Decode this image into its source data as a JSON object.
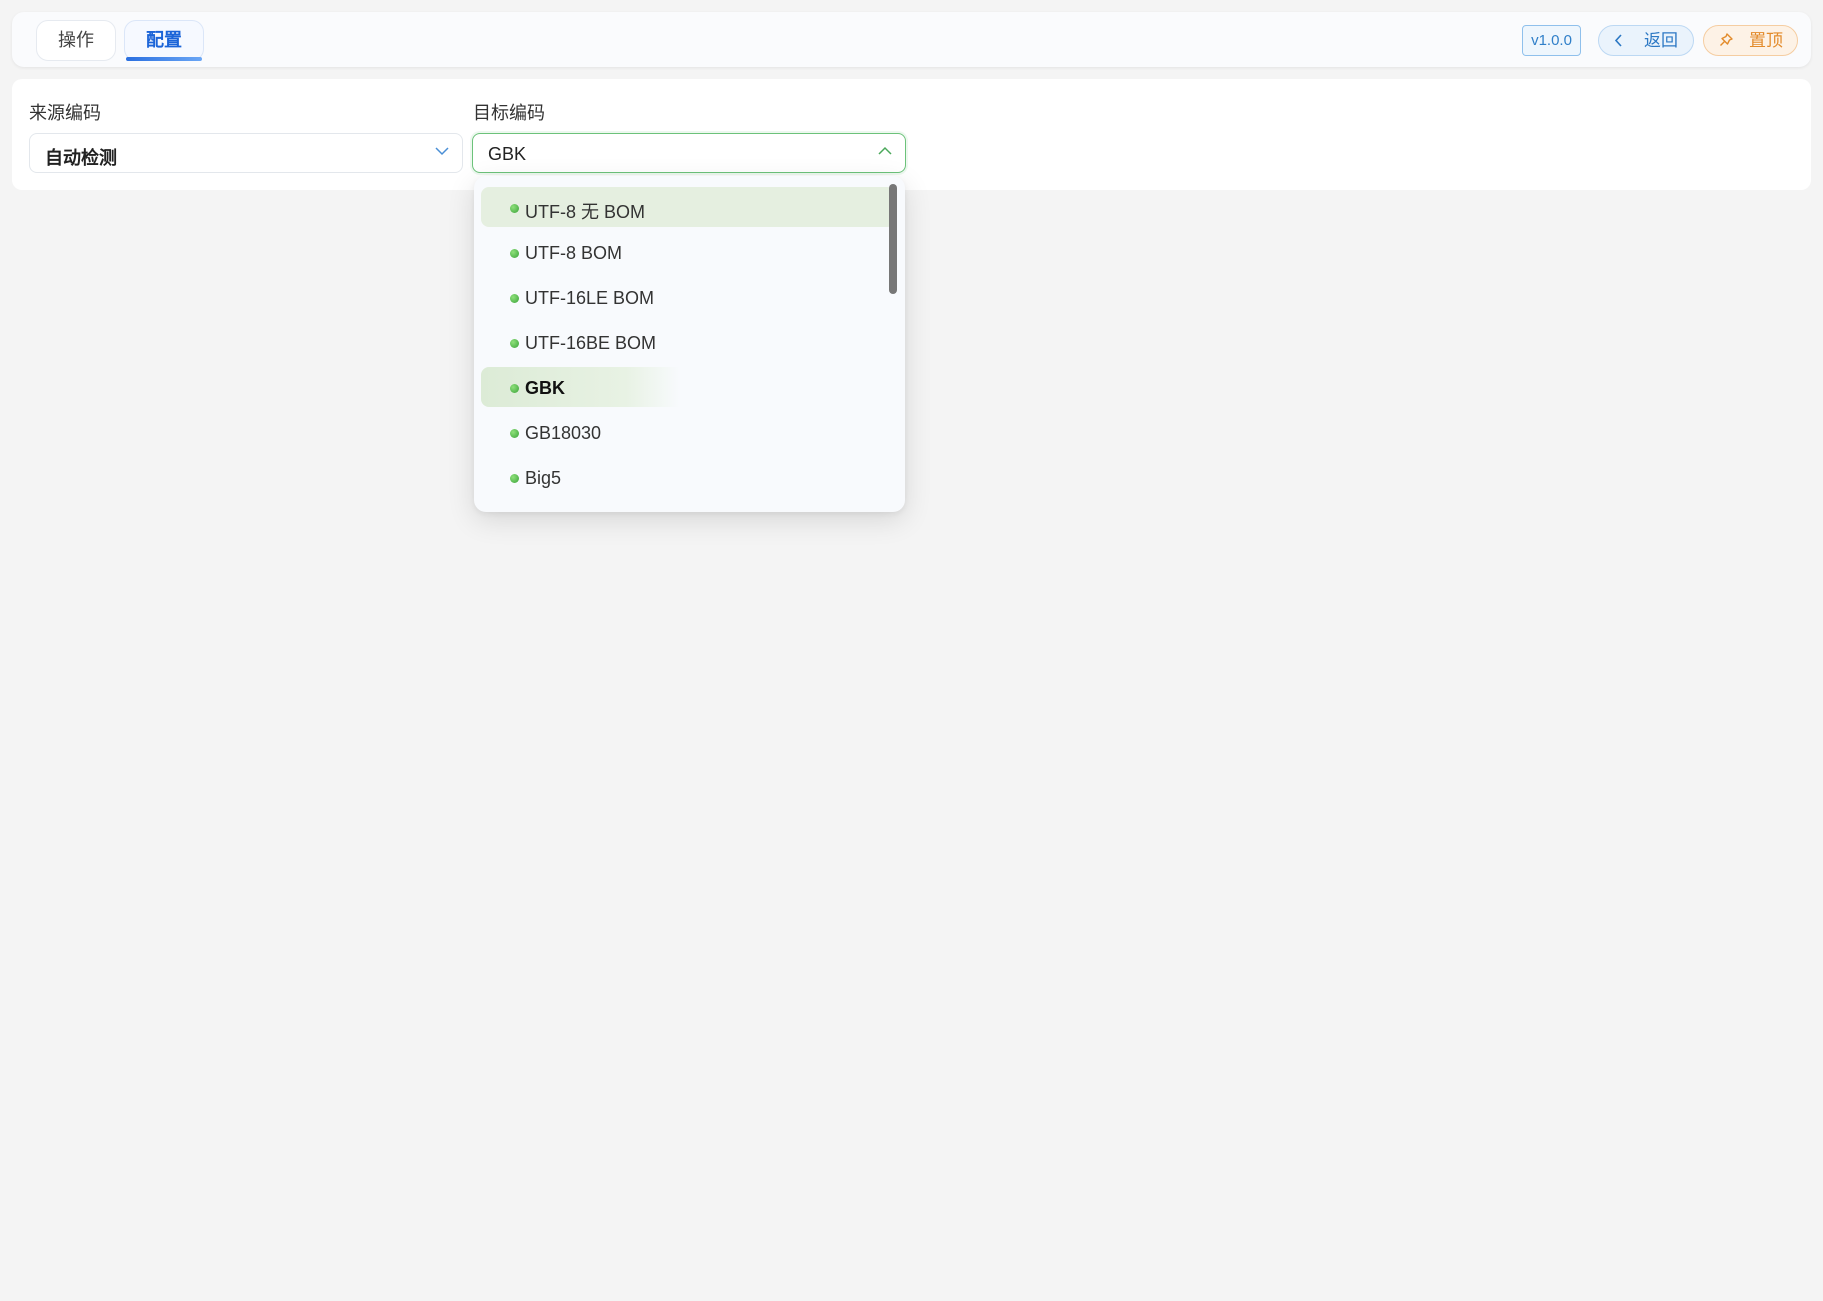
{
  "tabs": [
    {
      "label": "操作",
      "active": false
    },
    {
      "label": "配置",
      "active": true
    }
  ],
  "header": {
    "version": "v1.0.0",
    "back_label": "返回",
    "pin_label": "置顶",
    "back_icon": "chevron-left-icon",
    "pin_icon": "pin-icon"
  },
  "source": {
    "label": "来源编码",
    "value": "自动检测"
  },
  "target": {
    "label": "目标编码",
    "value": "GBK",
    "options": [
      "UTF-8 无 BOM",
      "UTF-8 BOM",
      "UTF-16LE BOM",
      "UTF-16BE BOM",
      "GBK",
      "GB18030",
      "Big5"
    ],
    "selected": "GBK",
    "hovered": "UTF-8 无 BOM"
  },
  "colors": {
    "accent_blue": "#1b64d8",
    "accent_green": "#6cc27a",
    "pin_orange": "#e38b2b"
  }
}
